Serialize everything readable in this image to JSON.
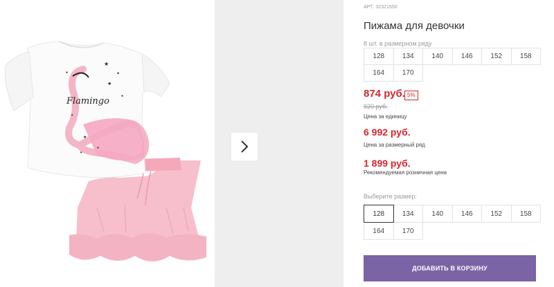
{
  "product": {
    "art_label": "АРТ.",
    "art_number": "32321550",
    "title": "Пижама для девочки",
    "size_count_label": "8 шт. в размерном ряду",
    "image_alt": "Пижама для девочки: футболка с фламинго и розовые шорты"
  },
  "row_sizes": [
    "128",
    "134",
    "140",
    "146",
    "152",
    "158",
    "164",
    "170"
  ],
  "prices": {
    "unit_price": "874 руб.",
    "discount_badge": "5%",
    "old_price": "920 руб.",
    "unit_label": "Цена за единицу",
    "row_price": "6 992 руб.",
    "row_label": "Цена за размерный ряд",
    "rrp_price": "1 899 руб.",
    "rrp_label": "Рекомендуемая розничная цена"
  },
  "size_select": {
    "label": "Выберите размер:",
    "options": [
      "128",
      "134",
      "140",
      "146",
      "152",
      "158",
      "164",
      "170"
    ],
    "selected": "128"
  },
  "actions": {
    "add_to_cart": "ДОБАВИТЬ В КОРЗИНУ",
    "next_icon": "chevron-right-icon"
  },
  "print": {
    "flamingo_text": "Flamingo"
  },
  "colors": {
    "accent_button": "#7a64a6",
    "price_red": "#d6262e",
    "panel_gray": "#eeeeee",
    "garment_pink": "#f7b7c6"
  }
}
